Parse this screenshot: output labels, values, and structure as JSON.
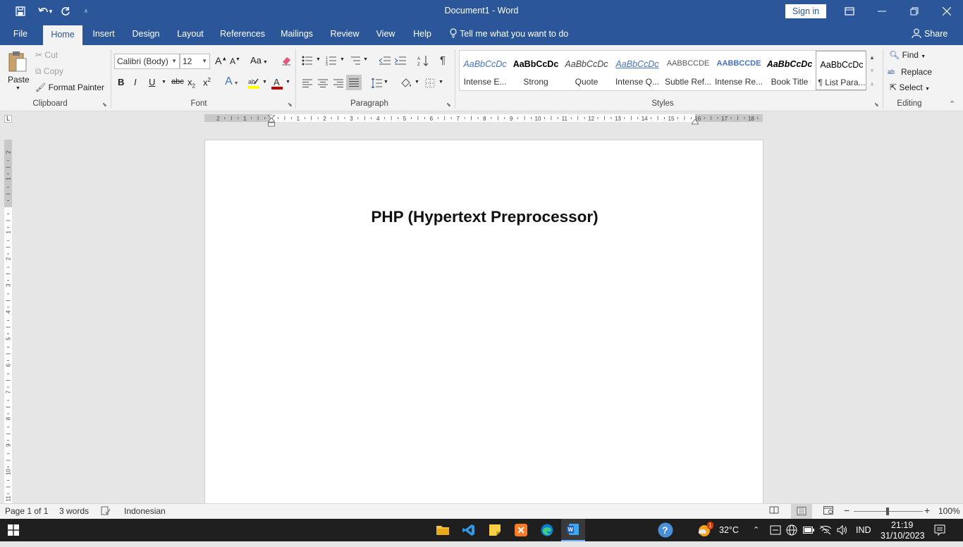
{
  "titlebar": {
    "doc_title": "Document1  -  Word",
    "sign_in": "Sign in"
  },
  "tabs": [
    "File",
    "Home",
    "Insert",
    "Design",
    "Layout",
    "References",
    "Mailings",
    "Review",
    "View",
    "Help"
  ],
  "tellme": "Tell me what you want to do",
  "share": "Share",
  "clipboard": {
    "paste": "Paste",
    "cut": "Cut",
    "copy": "Copy",
    "format_painter": "Format Painter",
    "label": "Clipboard"
  },
  "font": {
    "name": "Calibri (Body)",
    "size": "12",
    "label": "Font",
    "grow": "A",
    "shrink": "A",
    "case": "Aa",
    "bold": "B",
    "italic": "I",
    "underline": "U",
    "strike": "abc",
    "sub": "x",
    "sup": "x",
    "text_effects": "A",
    "font_color": "A"
  },
  "paragraph": {
    "label": "Paragraph",
    "pilcrow": "¶"
  },
  "styles": {
    "label": "Styles",
    "items": [
      {
        "preview": "AaBbCcDc",
        "name": "Intense E...",
        "color": "#4472c4"
      },
      {
        "preview": "AaBbCcDc",
        "name": "Strong",
        "color": "#000000"
      },
      {
        "preview": "AaBbCcDc",
        "name": "Quote",
        "color": "#404040"
      },
      {
        "preview": "AaBbCcDc",
        "name": "Intense Q...",
        "color": "#4472c4"
      },
      {
        "preview": "AABBCCDE",
        "name": "Subtle Ref...",
        "color": "#5a5a5a"
      },
      {
        "preview": "AABBCCDE",
        "name": "Intense Re...",
        "color": "#4472c4"
      },
      {
        "preview": "AaBbCcDc",
        "name": "Book Title",
        "color": "#000000"
      },
      {
        "preview": "AaBbCcDc",
        "name": "¶ List Para...",
        "color": "#000000"
      }
    ]
  },
  "editing": {
    "find": "Find",
    "replace": "Replace",
    "select": "Select",
    "label": "Editing"
  },
  "document": {
    "title": "PHP (Hypertext Preprocessor)"
  },
  "status": {
    "page": "Page 1 of 1",
    "words": "3 words",
    "language": "Indonesian",
    "zoom": "100%"
  },
  "taskbar": {
    "temperature": "32°C",
    "lang": "IND",
    "time": "21:19",
    "date": "31/10/2023",
    "weather_badge": "1"
  },
  "colors": {
    "word_blue": "#2b579a",
    "highlight": "#ffff00",
    "font_red": "#c00000"
  }
}
